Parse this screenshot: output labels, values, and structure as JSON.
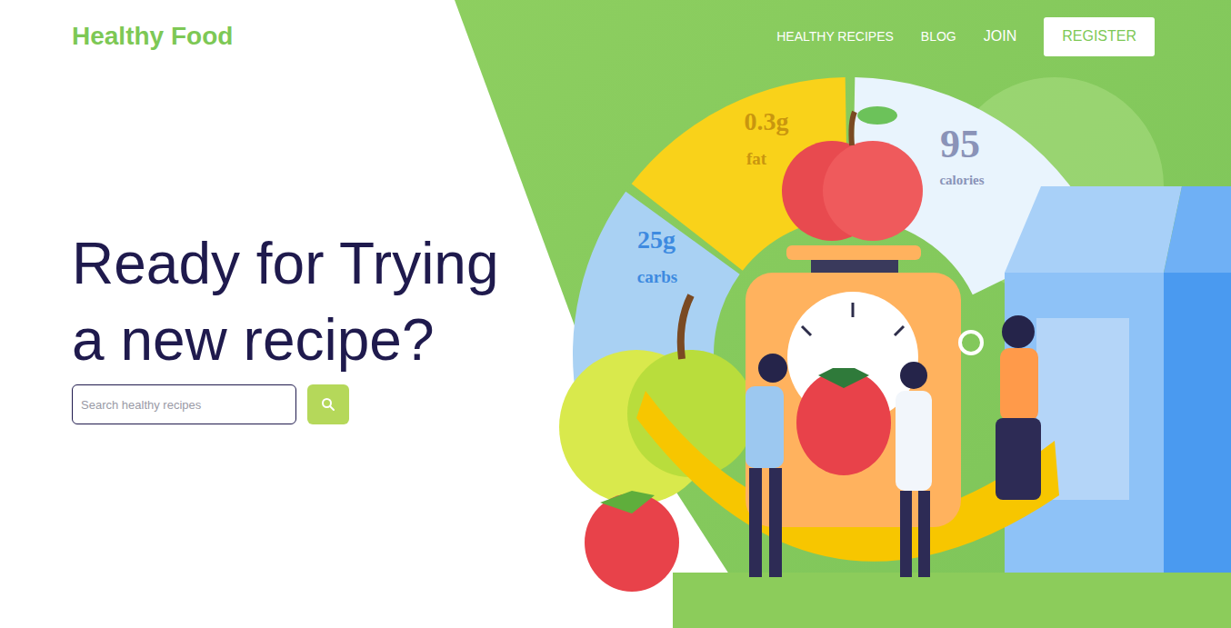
{
  "brand": {
    "name": "Healthy Food"
  },
  "nav": {
    "links": [
      {
        "label": "HEALTHY RECIPES"
      },
      {
        "label": "BLOG"
      },
      {
        "label": "JOIN"
      }
    ],
    "cta": {
      "label": "REGISTER"
    }
  },
  "hero": {
    "title_lines": [
      "Ready for Trying",
      "a new recipe?"
    ]
  },
  "search": {
    "placeholder": "Search healthy recipes"
  },
  "illustration": {
    "nutrients": [
      {
        "value": "0.3g",
        "unit": "fat",
        "color": "#f9d21a"
      },
      {
        "value": "95",
        "unit": "calories",
        "color": "#e9f4fd"
      },
      {
        "value": "25g",
        "unit": "carbs",
        "color": "#a9d1f3"
      }
    ]
  }
}
